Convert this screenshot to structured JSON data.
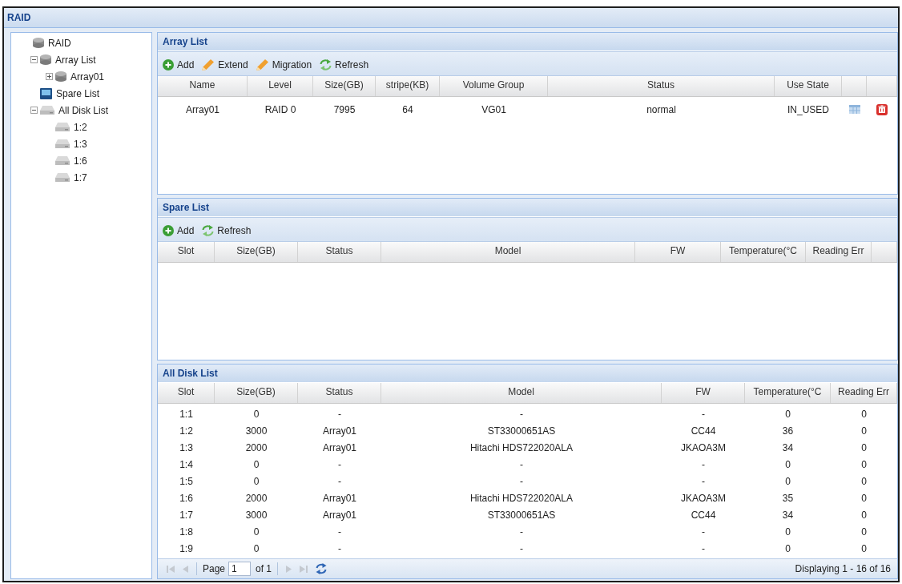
{
  "window": {
    "title": "RAID"
  },
  "tree": {
    "label": "RAID",
    "kind": "array",
    "children": [
      {
        "label": "Array List",
        "kind": "array",
        "expanded": true,
        "children": [
          {
            "label": "Array01",
            "kind": "array",
            "expanded": false
          }
        ]
      },
      {
        "label": "Spare List",
        "kind": "spare"
      },
      {
        "label": "All Disk List",
        "kind": "disks",
        "expanded": true,
        "children": [
          {
            "label": "1:2",
            "kind": "disk"
          },
          {
            "label": "1:3",
            "kind": "disk"
          },
          {
            "label": "1:6",
            "kind": "disk"
          },
          {
            "label": "1:7",
            "kind": "disk"
          }
        ]
      }
    ]
  },
  "array_list": {
    "title": "Array List",
    "toolbar": [
      {
        "label": "Add",
        "kind": "add"
      },
      {
        "label": "Extend",
        "kind": "edit"
      },
      {
        "label": "Migration",
        "kind": "edit"
      },
      {
        "label": "Refresh",
        "kind": "refresh"
      }
    ],
    "columns": [
      "Name",
      "Level",
      "Size(GB)",
      "stripe(KB)",
      "Volume Group",
      "Status",
      "Use State"
    ],
    "rows": [
      [
        "Array01",
        "RAID 0",
        "7995",
        "64",
        "VG01",
        "normal",
        "IN_USED"
      ]
    ]
  },
  "spare_list": {
    "title": "Spare List",
    "toolbar": [
      {
        "label": "Add",
        "kind": "add"
      },
      {
        "label": "Refresh",
        "kind": "refresh"
      }
    ],
    "columns": [
      "Slot",
      "Size(GB)",
      "Status",
      "Model",
      "FW",
      "Temperature(°C",
      "Reading Err"
    ]
  },
  "all_disk_list": {
    "title": "All Disk List",
    "columns": [
      "Slot",
      "Size(GB)",
      "Status",
      "Model",
      "FW",
      "Temperature(°C",
      "Reading Err"
    ],
    "rows": [
      [
        "1:1",
        "0",
        "-",
        "-",
        "-",
        "0",
        "0"
      ],
      [
        "1:2",
        "3000",
        "Array01",
        "ST33000651AS",
        "CC44",
        "36",
        "0"
      ],
      [
        "1:3",
        "2000",
        "Array01",
        "Hitachi HDS722020ALA",
        "JKAOA3M",
        "34",
        "0"
      ],
      [
        "1:4",
        "0",
        "-",
        "-",
        "-",
        "0",
        "0"
      ],
      [
        "1:5",
        "0",
        "-",
        "-",
        "-",
        "0",
        "0"
      ],
      [
        "1:6",
        "2000",
        "Array01",
        "Hitachi HDS722020ALA",
        "JKAOA3M",
        "35",
        "0"
      ],
      [
        "1:7",
        "3000",
        "Array01",
        "ST33000651AS",
        "CC44",
        "34",
        "0"
      ],
      [
        "1:8",
        "0",
        "-",
        "-",
        "-",
        "0",
        "0"
      ],
      [
        "1:9",
        "0",
        "-",
        "-",
        "-",
        "0",
        "0"
      ]
    ],
    "pager": {
      "nav_before": [
        {
          "kind": "first",
          "disabled": true
        },
        {
          "kind": "prev",
          "disabled": true
        }
      ],
      "page_label": "Page",
      "page": "1",
      "page_count": "of 1",
      "nav_after": [
        {
          "kind": "next",
          "disabled": true
        },
        {
          "kind": "last",
          "disabled": true
        },
        {
          "kind": "refresh"
        }
      ],
      "info": "Displaying 1 - 16 of 16"
    }
  }
}
